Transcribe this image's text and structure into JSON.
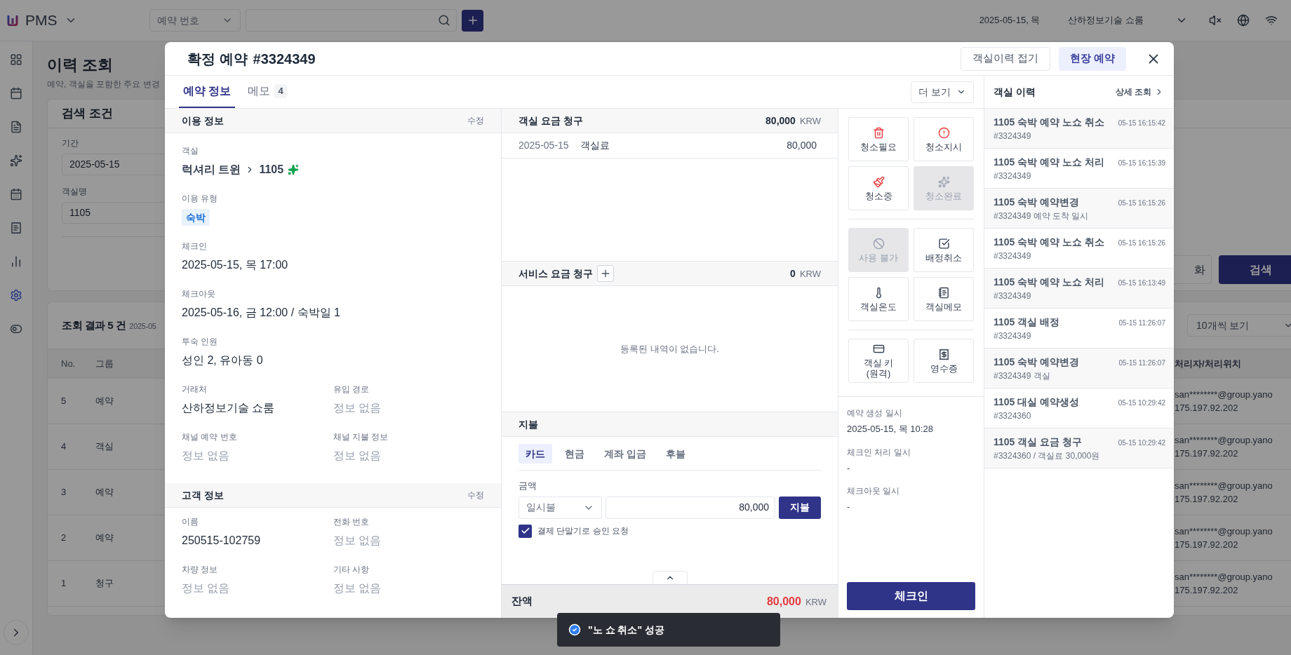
{
  "topbar": {
    "app_name": "PMS",
    "search_type": "예약 번호",
    "date": "2025-05-15, 목",
    "property": "산하정보기술 쇼룸"
  },
  "sidebar": {
    "items": [
      {
        "selected": false
      },
      {
        "selected": false
      },
      {
        "selected": false
      },
      {
        "selected": false
      },
      {
        "selected": false
      },
      {
        "selected": false
      },
      {
        "selected": false
      },
      {
        "selected": true
      },
      {
        "selected": false
      }
    ]
  },
  "page": {
    "title": "이력 조회",
    "subtitle": "예약, 객실을 포함한 주요 변경"
  },
  "search_card": {
    "title": "검색 조건",
    "fields": [
      {
        "label": "기간",
        "value": "2025-05-15"
      },
      {
        "label": "객실명",
        "value": "1105"
      }
    ],
    "reset_button": "화",
    "search_button": "검색"
  },
  "results": {
    "title": "조회 결과 5 건",
    "period": "2025-05",
    "page_size": "10개씩 보기",
    "columns": [
      "No.",
      "그룹",
      "처리자/처리위치"
    ],
    "rows": [
      {
        "no": "5",
        "group": "예약",
        "handler": "san********@group.yano",
        "location": "175.197.92.202"
      },
      {
        "no": "4",
        "group": "객실",
        "handler": "san********@group.yano",
        "location": "175.197.92.202"
      },
      {
        "no": "3",
        "group": "예약",
        "handler": "san********@group.yano",
        "location": "175.197.92.202"
      },
      {
        "no": "2",
        "group": "예약",
        "handler": "san********@group.yano",
        "location": "175.197.92.202"
      },
      {
        "no": "1",
        "group": "청구",
        "handler": "san********@group.yano",
        "location": "175.197.92.202"
      }
    ]
  },
  "modal": {
    "status": "확정 예약",
    "number": "#3324349",
    "header_buttons": [
      {
        "label": "객실이력 접기",
        "kind": "outline"
      },
      {
        "label": "현장 예약",
        "kind": "accent"
      }
    ],
    "tabs": [
      {
        "label": "예약 정보",
        "selected": true
      },
      {
        "label": "메모",
        "count": "4",
        "selected": false
      }
    ],
    "more_button": "더 보기",
    "usage": {
      "title": "이용 정보",
      "edit": "수정",
      "fields": [
        {
          "label": "객실",
          "kind": "room",
          "room_type": "럭셔리 트윈",
          "room_number": "1105"
        },
        {
          "label": "이용 유형",
          "kind": "badge",
          "value": "숙박"
        },
        {
          "label": "체크인",
          "kind": "text",
          "value": "2025-05-15, 목 17:00"
        },
        {
          "label": "체크아웃",
          "kind": "text",
          "value": "2025-05-16, 금 12:00 / 숙박일 1"
        },
        {
          "label": "투숙 인원",
          "kind": "text",
          "value": "성인 2, 유아동 0"
        }
      ],
      "pairs": [
        {
          "label": "거래처",
          "value": "산하정보기술 쇼룸",
          "empty": false
        },
        {
          "label": "유입 경로",
          "value": "정보 없음",
          "empty": true
        },
        {
          "label": "채널 예약 번호",
          "value": "정보 없음",
          "empty": true
        },
        {
          "label": "채널 지불 정보",
          "value": "정보 없음",
          "empty": true
        }
      ]
    },
    "guest": {
      "title": "고객 정보",
      "edit": "수정",
      "pairs": [
        {
          "label": "이름",
          "value": "250515-102759",
          "empty": false
        },
        {
          "label": "전화 번호",
          "value": "정보 없음",
          "empty": true
        },
        {
          "label": "차량 정보",
          "value": "정보 없음",
          "empty": true
        },
        {
          "label": "기타 사항",
          "value": "정보 없음",
          "empty": true
        }
      ]
    },
    "room_charges": {
      "title": "객실 요금 청구",
      "total": "80,000",
      "currency": "KRW",
      "rows": [
        {
          "date": "2025-05-15",
          "item": "객실료",
          "amount": "80,000"
        }
      ]
    },
    "service_charges": {
      "title": "서비스 요금 청구",
      "total": "0",
      "currency": "KRW",
      "empty_text": "등록된 내역이 없습니다."
    },
    "payment": {
      "title": "지불",
      "methods": [
        {
          "label": "카드",
          "selected": true
        },
        {
          "label": "현금",
          "selected": false
        },
        {
          "label": "계좌 입금",
          "selected": false
        },
        {
          "label": "후불",
          "selected": false
        }
      ],
      "amount_label": "금액",
      "plan": "일시불",
      "amount": "80,000",
      "pay_button": "지불",
      "terminal": {
        "label": "결제 단말기로 승인 요청",
        "checked": true
      }
    },
    "balance": {
      "label": "잔액",
      "amount": "80,000",
      "currency": "KRW"
    },
    "actions": {
      "groups": [
        {
          "buttons": [
            {
              "label": "청소필요",
              "disabled": false
            },
            {
              "label": "청소지시",
              "disabled": false
            },
            {
              "label": "청소중",
              "disabled": false
            },
            {
              "label": "청소완료",
              "disabled": true
            }
          ]
        },
        {
          "buttons": [
            {
              "label": "사용 불가",
              "disabled": true
            },
            {
              "label": "배정취소",
              "disabled": false
            },
            {
              "label": "객실온도",
              "disabled": false
            },
            {
              "label": "객실메모",
              "disabled": false
            }
          ]
        },
        {
          "buttons": [
            {
              "label": "객실 키\n(원격)",
              "disabled": false
            },
            {
              "label": "영수증",
              "disabled": false
            }
          ]
        }
      ]
    },
    "timestamps": [
      {
        "label": "예약 생성 일시",
        "value": "2025-05-15, 목 10:28"
      },
      {
        "label": "체크인 처리 일시",
        "value": "-"
      },
      {
        "label": "체크아웃 일시",
        "value": "-"
      }
    ],
    "checkin_button": "체크인",
    "history": {
      "title": "객실 이력",
      "detail_link": "상세 조회",
      "items": [
        {
          "title": "1105 숙박 예약 노쇼 취소",
          "time": "05-15 16:15:42",
          "detail": "#3324349"
        },
        {
          "title": "1105 숙박 예약 노쇼 처리",
          "time": "05-15 16:15:39",
          "detail": "#3324349"
        },
        {
          "title": "1105 숙박 예약변경",
          "time": "05-15 16:15:26",
          "detail": "#3324349 예약 도착 일시"
        },
        {
          "title": "1105 숙박 예약 노쇼 취소",
          "time": "05-15 16:15:26",
          "detail": "#3324349"
        },
        {
          "title": "1105 숙박 예약 노쇼 처리",
          "time": "05-15 16:13:49",
          "detail": "#3324349"
        },
        {
          "title": "1105 객실 배정",
          "time": "05-15 11:26:07",
          "detail": "#3324349"
        },
        {
          "title": "1105 숙박 예약변경",
          "time": "05-15 11:26:07",
          "detail": "#3324349 객실"
        },
        {
          "title": "1105 대실 예약생성",
          "time": "05-15 10:29:42",
          "detail": "#3324360"
        },
        {
          "title": "1105 객실 요금 청구",
          "time": "05-15 10:29:42",
          "detail": "#3324360 / 객실료 30,000원"
        }
      ]
    }
  },
  "toast": {
    "message": "\"노 쇼 취소\" 성공"
  }
}
